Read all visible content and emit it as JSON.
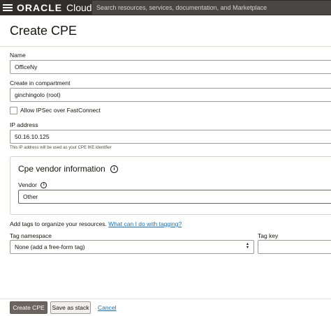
{
  "topbar": {
    "logo_oracle": "ORACLE",
    "logo_cloud": "Cloud",
    "search_placeholder": "Search resources, services, documentation, and Marketplace"
  },
  "page": {
    "title": "Create CPE"
  },
  "form": {
    "name_label": "Name",
    "name_value": "OfficeNy",
    "compartment_label": "Create in compartment",
    "compartment_value": "ginchingolo (root)",
    "ipsec_checkbox_label": "Allow IPSec over FastConnect",
    "ipsec_checked": false,
    "ip_label": "IP address",
    "ip_value": "50.16.10.125",
    "ip_hint": "This IP address will be used as your CPE IKE identifier",
    "vendor_section_title": "Cpe vendor information",
    "vendor_label": "Vendor",
    "vendor_value": "Other",
    "tags_intro": "Add tags to organize your resources.",
    "tags_link": "What can I do with tagging?",
    "tag_namespace_label": "Tag namespace",
    "tag_namespace_value": "None (add a free-form tag)",
    "tag_key_label": "Tag key",
    "tag_key_value": ""
  },
  "footer": {
    "create_label": "Create CPE",
    "save_stack_label": "Save as stack",
    "cancel_label": "Cancel"
  },
  "colors": {
    "topbar": "#312d2a",
    "link": "#1a6ea8",
    "primary_button": "#6b6560"
  }
}
